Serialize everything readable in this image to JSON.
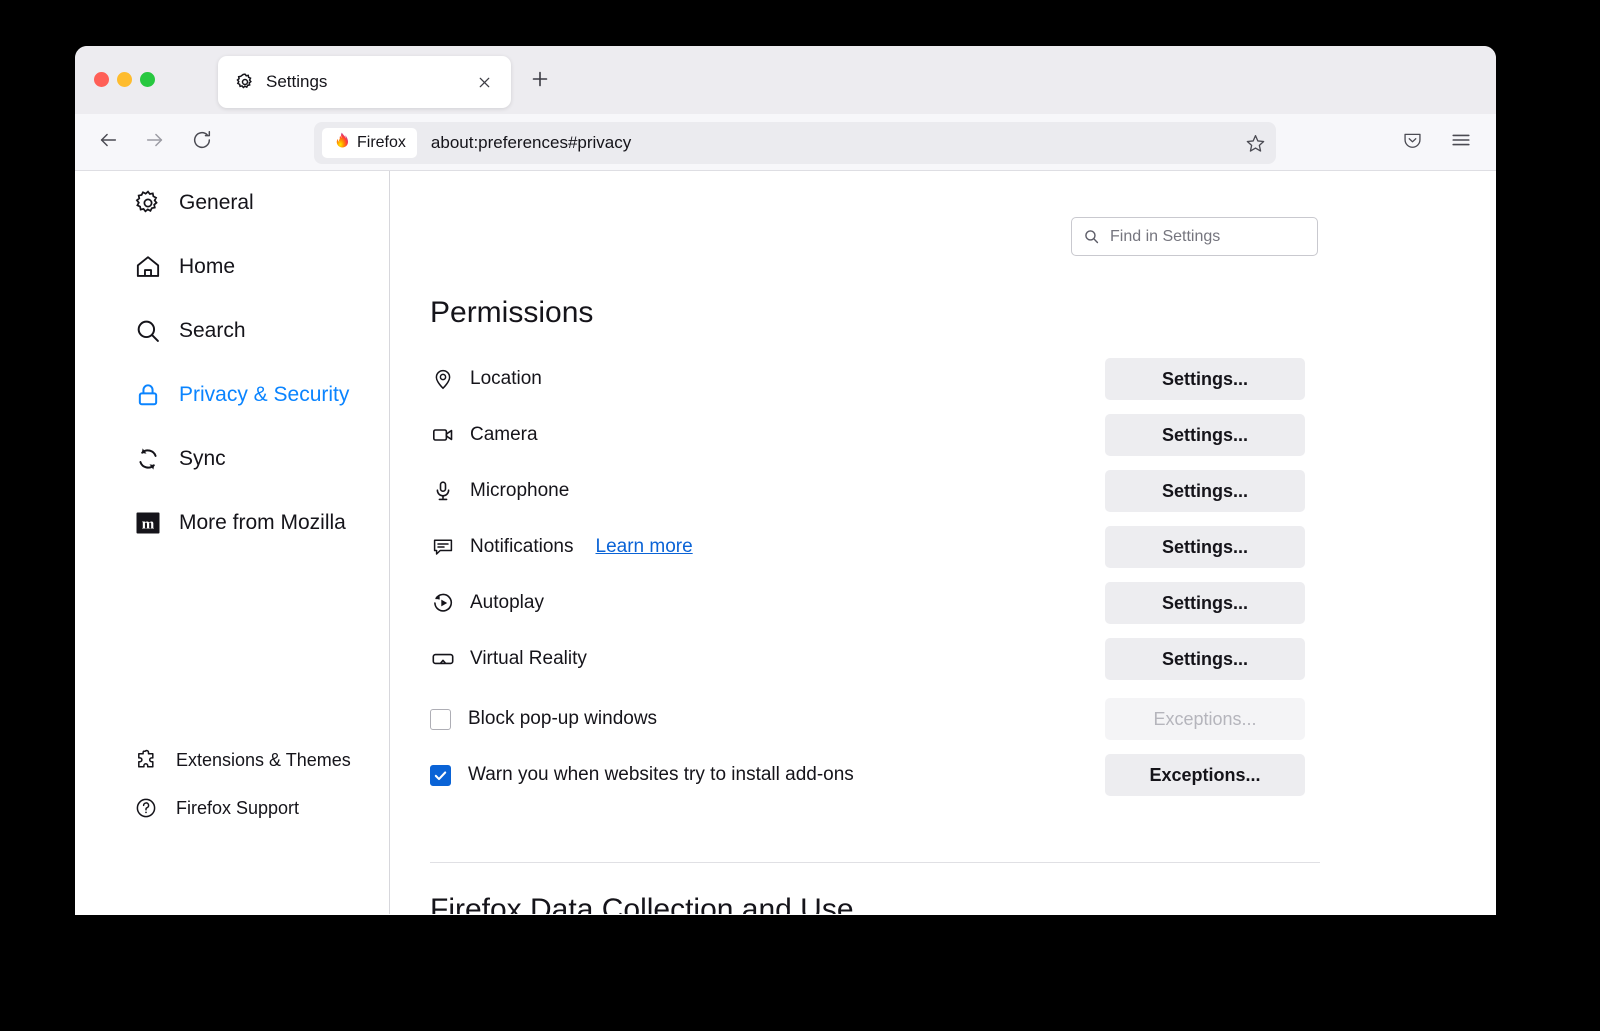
{
  "window": {
    "traffic_lights": [
      "close",
      "minimize",
      "maximize"
    ]
  },
  "tabbar": {
    "tab_title": "Settings",
    "tab_favicon": "gear-icon",
    "close_icon": "close-icon",
    "new_tab_icon": "plus-icon"
  },
  "toolbar": {
    "back_icon": "arrow-left-icon",
    "forward_icon": "arrow-right-icon",
    "reload_icon": "reload-icon",
    "chip_label": "Firefox",
    "chip_icon": "firefox-logo-icon",
    "url": "about:preferences#privacy",
    "bookmark_icon": "star-icon",
    "pocket_icon": "pocket-icon",
    "menu_icon": "hamburger-menu-icon"
  },
  "sidebar": {
    "items": [
      {
        "label": "General",
        "icon": "gear-icon",
        "selected": false
      },
      {
        "label": "Home",
        "icon": "home-icon",
        "selected": false
      },
      {
        "label": "Search",
        "icon": "search-icon",
        "selected": false
      },
      {
        "label": "Privacy & Security",
        "icon": "lock-icon",
        "selected": true
      },
      {
        "label": "Sync",
        "icon": "sync-icon",
        "selected": false
      },
      {
        "label": "More from Mozilla",
        "icon": "mozilla-m-icon",
        "selected": false
      }
    ],
    "footer": [
      {
        "label": "Extensions & Themes",
        "icon": "puzzle-piece-icon"
      },
      {
        "label": "Firefox Support",
        "icon": "question-circle-icon"
      }
    ]
  },
  "search": {
    "placeholder": "Find in Settings",
    "value": "",
    "icon": "search-icon"
  },
  "main": {
    "section_title": "Permissions",
    "permissions": [
      {
        "label": "Location",
        "icon": "location-pin-icon",
        "link": "",
        "button": "Settings...",
        "disabled": false
      },
      {
        "label": "Camera",
        "icon": "camera-icon",
        "link": "",
        "button": "Settings...",
        "disabled": false
      },
      {
        "label": "Microphone",
        "icon": "microphone-icon",
        "link": "",
        "button": "Settings...",
        "disabled": false
      },
      {
        "label": "Notifications",
        "icon": "notification-icon",
        "link": "Learn more",
        "button": "Settings...",
        "disabled": false
      },
      {
        "label": "Autoplay",
        "icon": "autoplay-icon",
        "link": "",
        "button": "Settings...",
        "disabled": false
      },
      {
        "label": "Virtual Reality",
        "icon": "vr-headset-icon",
        "link": "",
        "button": "Settings...",
        "disabled": false
      }
    ],
    "checkboxes": [
      {
        "label": "Block pop-up windows",
        "checked": false,
        "button": "Exceptions...",
        "button_disabled": true
      },
      {
        "label": "Warn you when websites try to install add-ons",
        "checked": true,
        "button": "Exceptions...",
        "button_disabled": false
      }
    ],
    "next_section_title": "Firefox Data Collection and Use"
  },
  "colors": {
    "accent": "#0a84ff",
    "link": "#0a63d6",
    "chrome": "#edecf0",
    "navbar": "#f7f7fa",
    "button": "#ededf0"
  }
}
